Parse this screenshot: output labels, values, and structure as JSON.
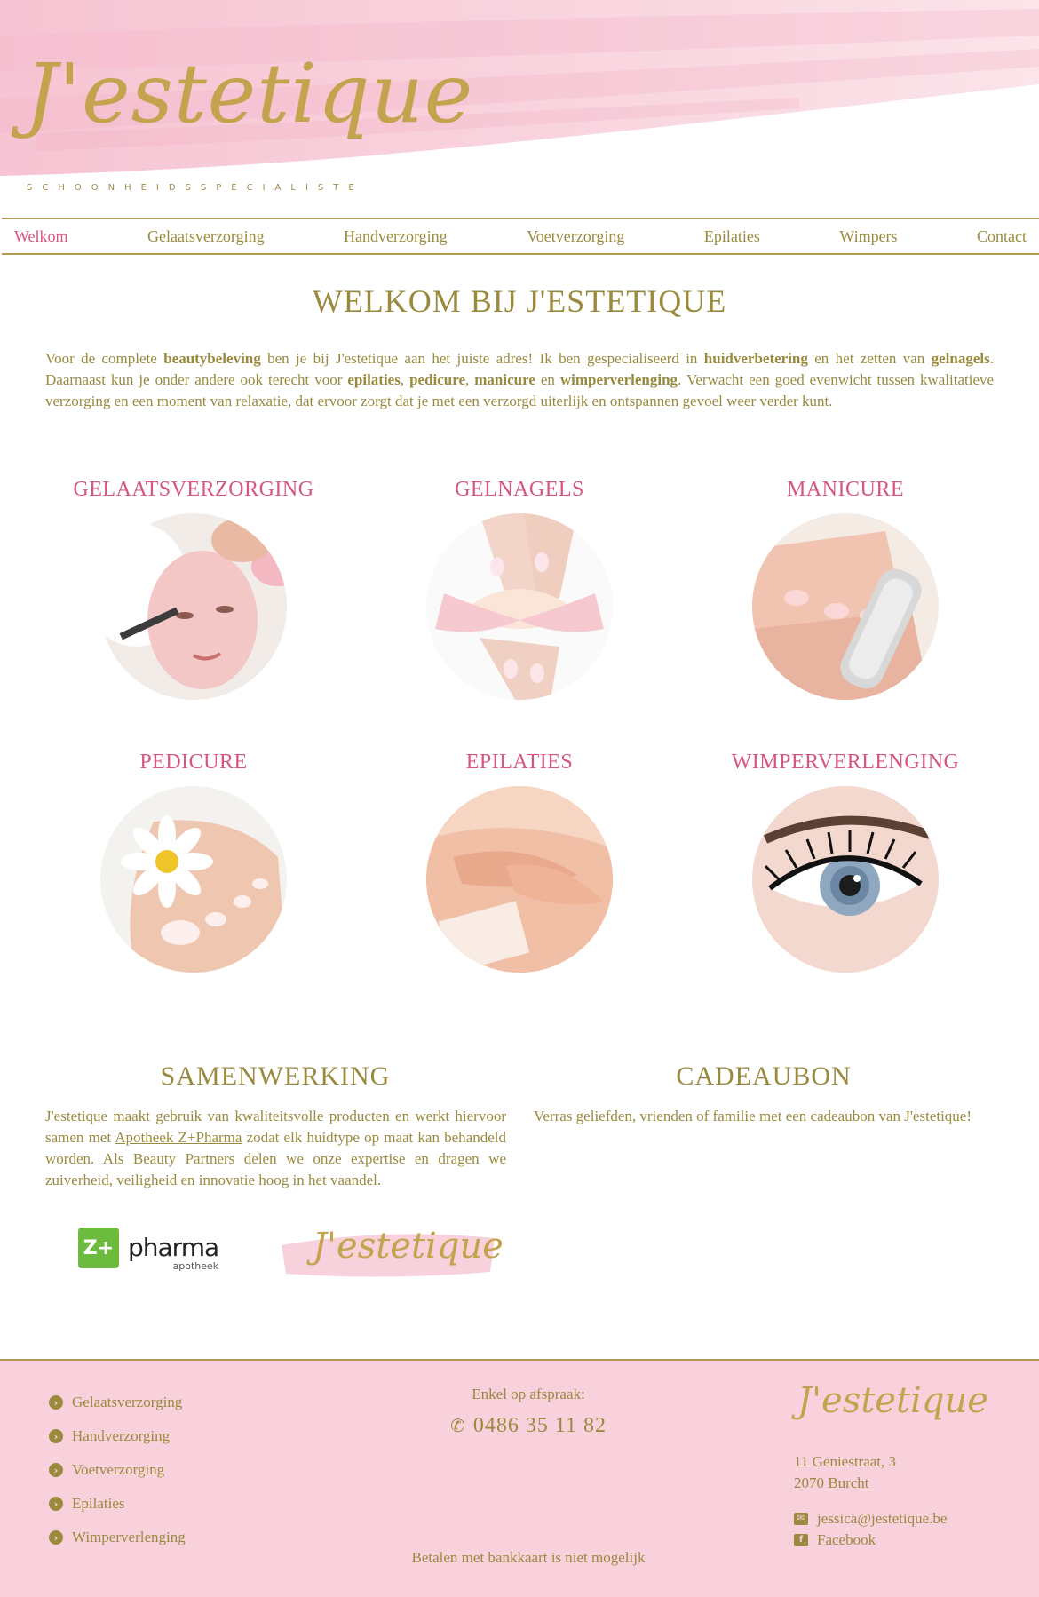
{
  "header": {
    "logo_script": "J'estetique",
    "logo_subtitle": "SCHOONHEIDSSPECIALISTE"
  },
  "nav": {
    "items": [
      {
        "label": "Welkom",
        "active": true
      },
      {
        "label": "Gelaatsverzorging"
      },
      {
        "label": "Handverzorging"
      },
      {
        "label": "Voetverzorging"
      },
      {
        "label": "Epilaties"
      },
      {
        "label": "Wimpers"
      },
      {
        "label": "Contact"
      }
    ]
  },
  "intro": {
    "title": "WELKOM BIJ J'ESTETIQUE",
    "p1": "Voor de complete ",
    "b1": "beautybeleving",
    "p2": " ben je bij J'estetique aan het juiste adres! Ik ben gespecialiseerd in ",
    "b2": "huidverbetering",
    "p3": " en het zetten van ",
    "b3": "gelnagels",
    "p4": ". Daarnaast kun je onder andere ook terecht voor ",
    "b4": "epilaties",
    "p5": ", ",
    "b5": "pedicure",
    "p6": ", ",
    "b6": "manicure",
    "p7": " en ",
    "b7": "wimperverlenging",
    "p8": ". Verwacht een goed evenwicht tussen kwalitatieve verzorging en een moment van relaxatie, dat ervoor zorgt dat je met een verzorgd uiterlijk en ontspannen gevoel weer verder kunt."
  },
  "services": [
    {
      "title": "GELAATSVERZORGING"
    },
    {
      "title": "GELNAGELS"
    },
    {
      "title": "MANICURE"
    },
    {
      "title": "PEDICURE"
    },
    {
      "title": "EPILATIES"
    },
    {
      "title": "WIMPERVERLENGING"
    }
  ],
  "samenwerking": {
    "title": "SAMENWERKING",
    "t1": "J'estetique maakt gebruik van kwaliteitsvolle producten en werkt hiervoor samen met ",
    "link": "Apotheek Z+Pharma",
    "t2": " zodat elk huidtype op maat kan behandeld worden. Als Beauty Partners delen we onze expertise en dragen we zuiverheid, veiligheid en innovatie hoog in het vaandel.",
    "pharma_badge": "Z+",
    "pharma_word": "pharma",
    "pharma_sub": "apotheek",
    "partner_logo": "J'estetique"
  },
  "cadeaubon": {
    "title": "CADEAUBON",
    "text": "Verras geliefden, vrienden of familie met een cadeaubon van J'estetique!"
  },
  "footer": {
    "links": [
      "Gelaatsverzorging",
      "Handverzorging",
      "Voetverzorging",
      "Epilaties",
      "Wimperverlenging"
    ],
    "appointment": "Enkel op afspraak:",
    "phone": "0486 35 11 82",
    "payment_note": "Betalen met bankkaart is niet mogelijk",
    "logo": "J'estetique",
    "address1": "11 Geniestraat, 3",
    "address2": "2070 Burcht",
    "email": "jessica@jestetique.be",
    "facebook": "Facebook"
  },
  "colors": {
    "gold": "#9a8a3e",
    "pink_accent": "#d65683",
    "footer_bg": "#f8d1dd"
  }
}
